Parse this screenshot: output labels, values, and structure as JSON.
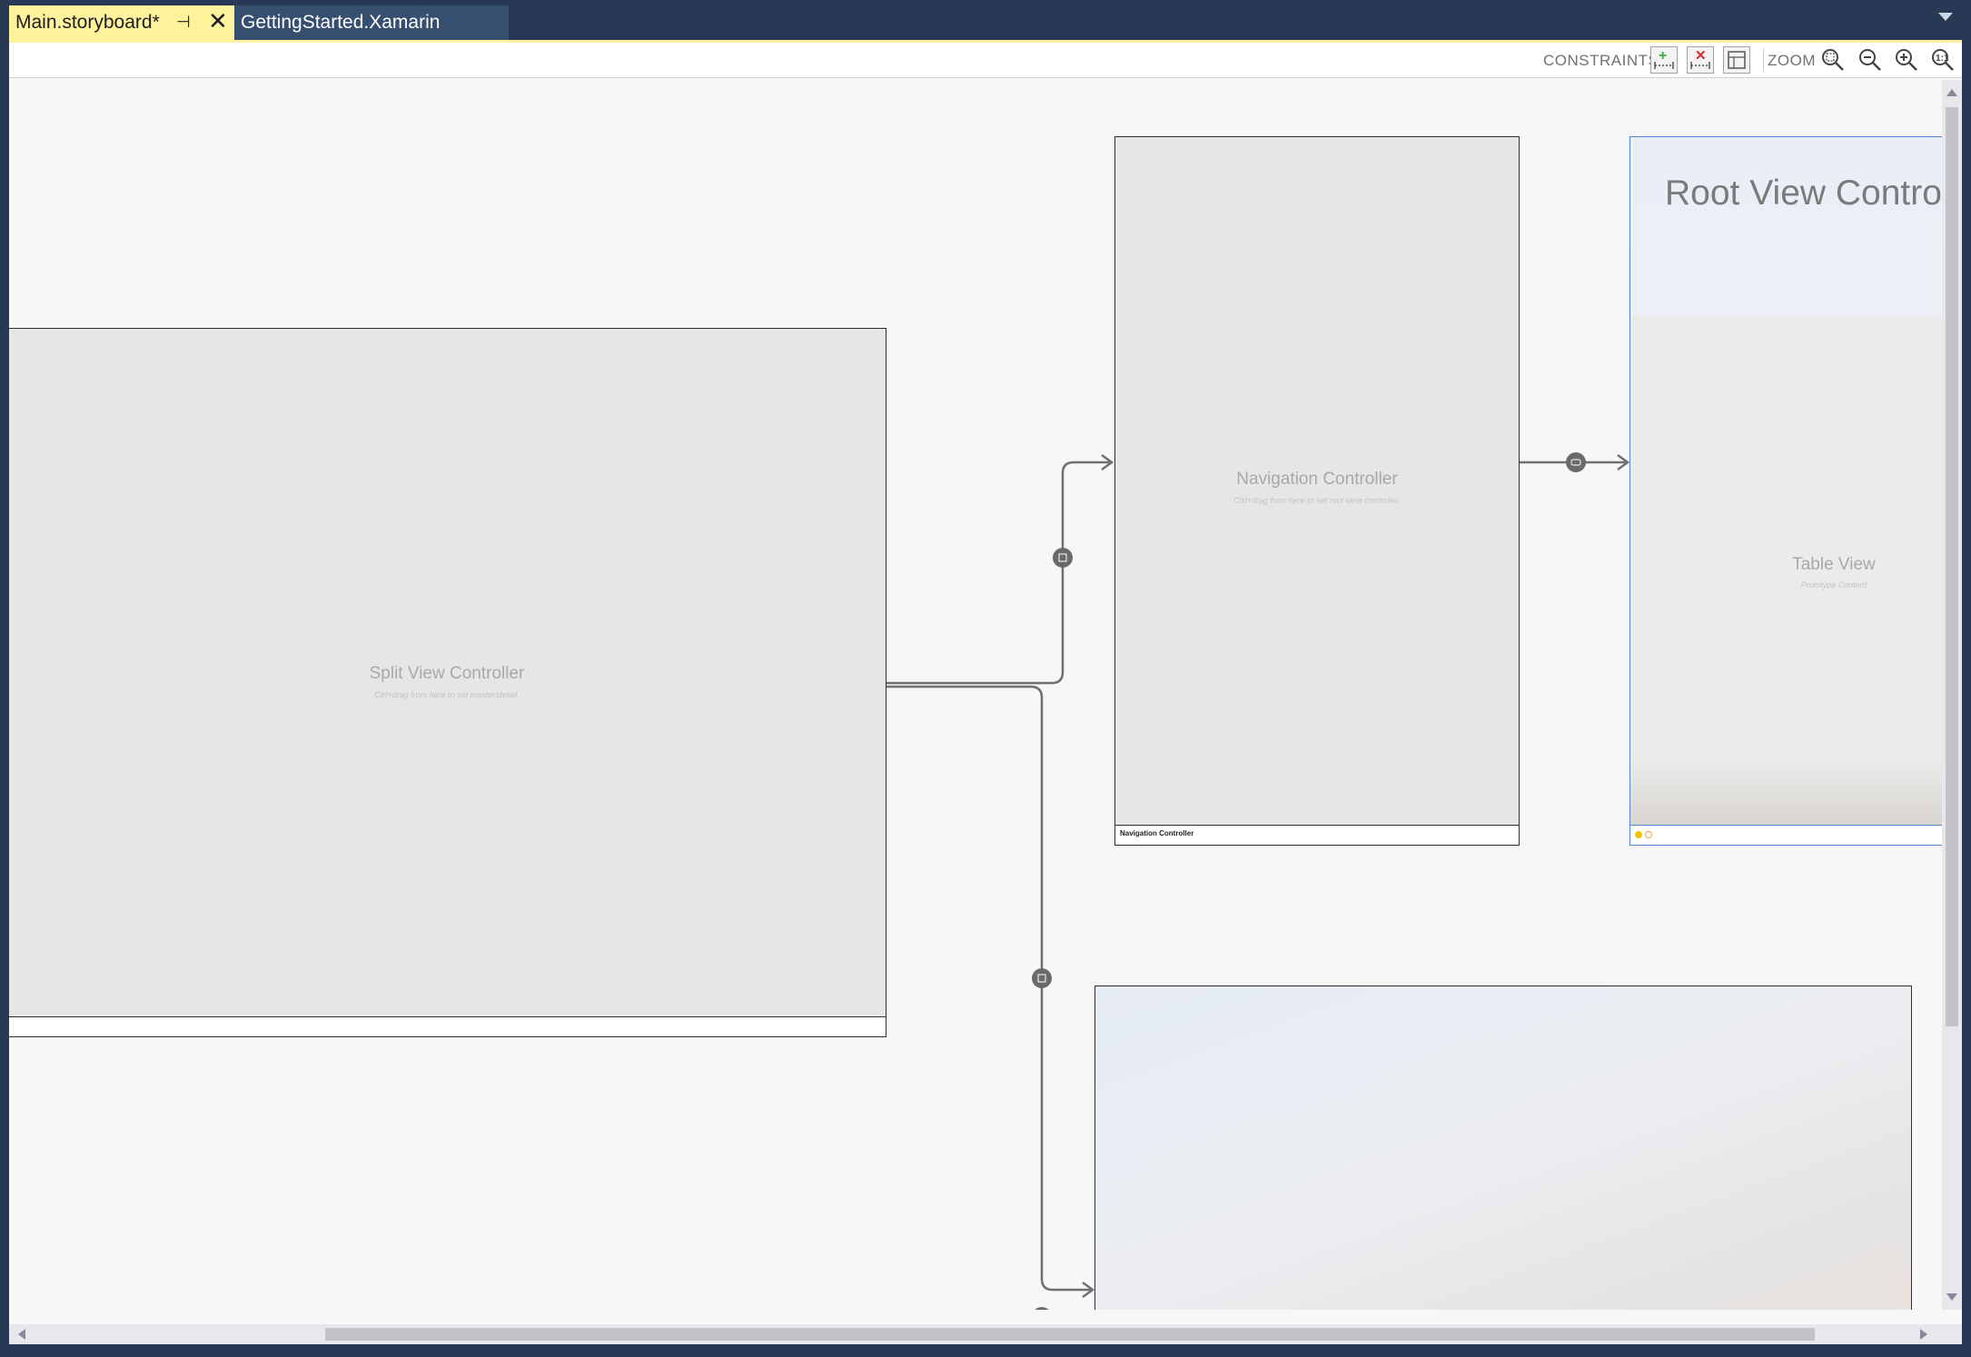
{
  "tabs": [
    {
      "label": "Main.storyboard*",
      "active": true
    },
    {
      "label": "GettingStarted.Xamarin",
      "active": false
    }
  ],
  "toolbar": {
    "constraints_label": "CONSTRAINTS",
    "zoom_label": "ZOOM",
    "buttons": [
      "add-constraints",
      "remove-constraints",
      "frame-toggle"
    ],
    "zoom_buttons": [
      "zoom-to-fit",
      "zoom-out",
      "zoom-in",
      "zoom-reset"
    ]
  },
  "scenes": {
    "split": {
      "title": "Split View Controller",
      "subtitle": "Ctrl+drag from here to set master/detail."
    },
    "navigation": {
      "title": "Navigation Controller",
      "subtitle": "Ctrl+drag from here to set root view controller.",
      "footer": "Navigation Controller"
    },
    "root": {
      "title": "Root View Contro",
      "table_title": "Table View",
      "table_sub": "Prototype Content"
    }
  },
  "colors": {
    "chrome": "#293955",
    "active_tab": "#fff29d",
    "inactive_tab": "#364e6f",
    "canvas": "#f7f7f7",
    "scene": "#e6e6e6",
    "selection": "#4a88d8"
  }
}
